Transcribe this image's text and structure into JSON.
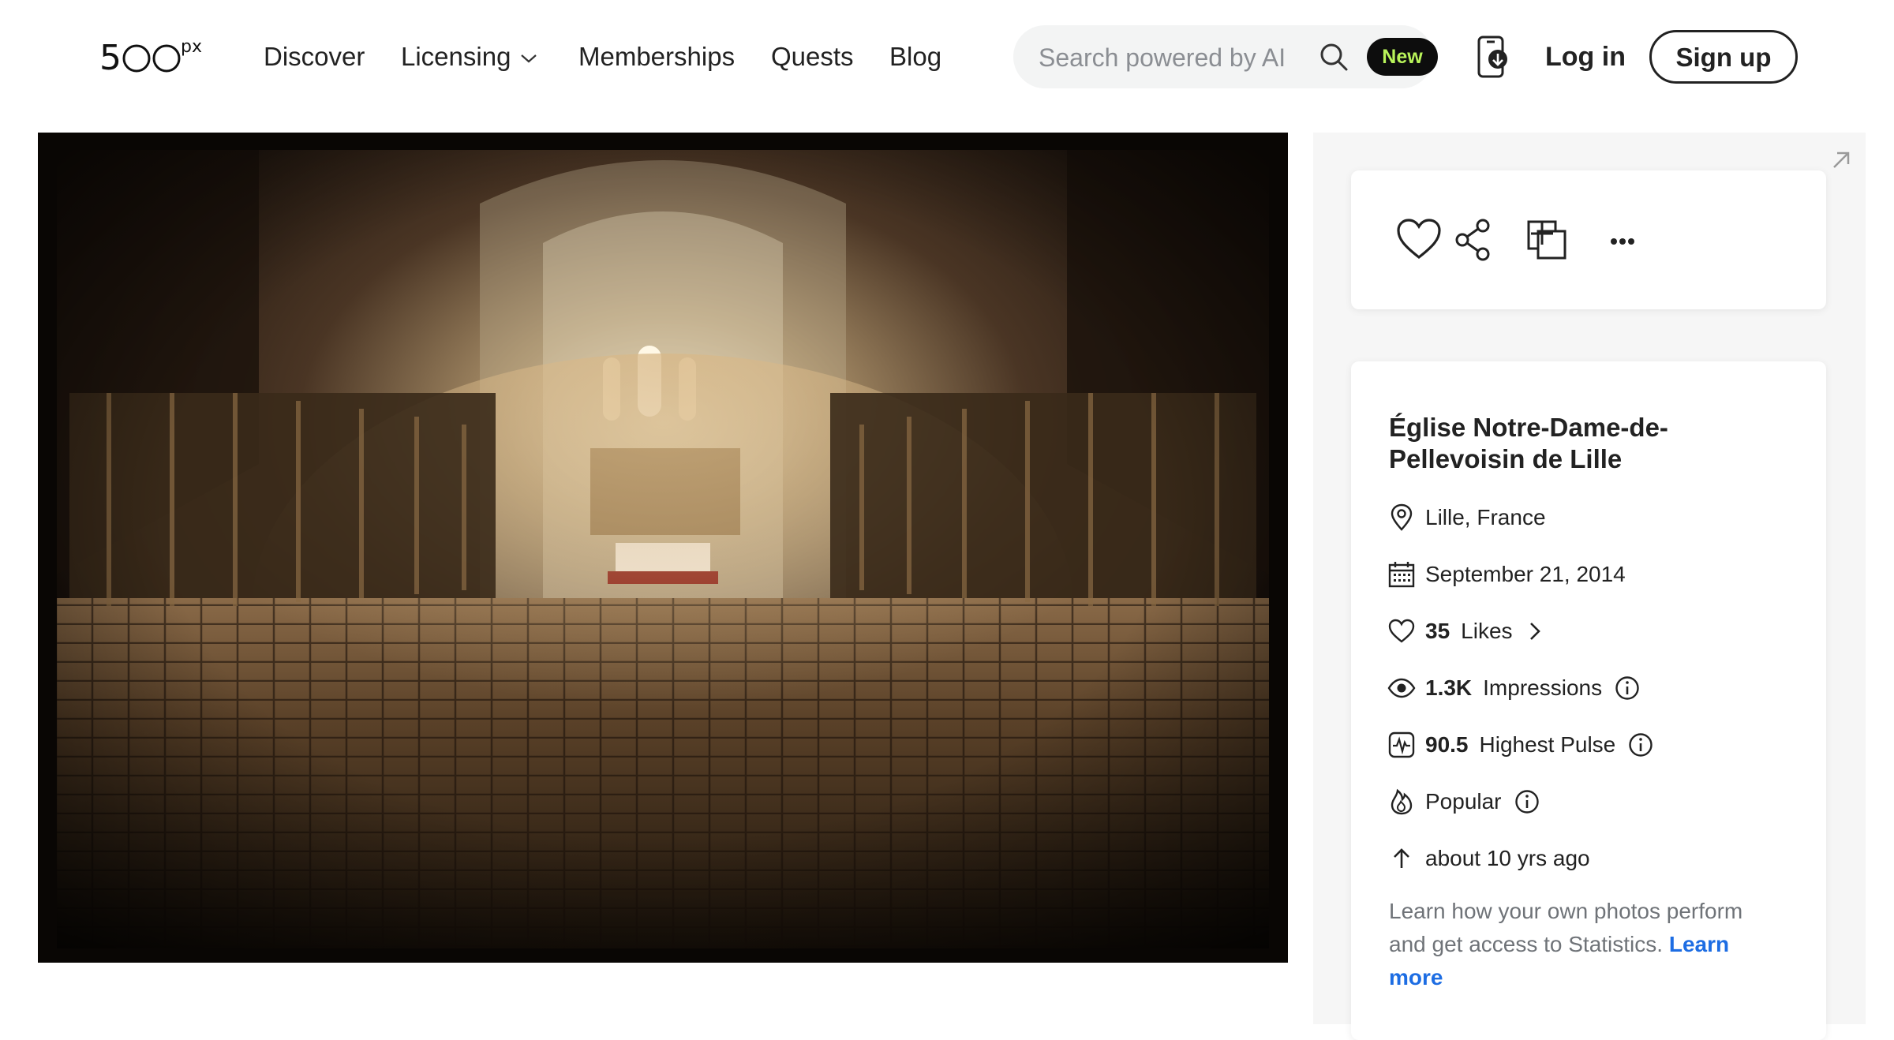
{
  "header": {
    "logo_text": "500px",
    "nav": [
      {
        "label": "Discover"
      },
      {
        "label": "Licensing"
      },
      {
        "label": "Memberships"
      },
      {
        "label": "Quests"
      },
      {
        "label": "Blog"
      }
    ],
    "search": {
      "placeholder": "Search powered by AI",
      "badge": "New"
    },
    "login_label": "Log in",
    "signup_label": "Sign up"
  },
  "photo": {
    "title": "Église Notre-Dame-de-Pellevoisin de Lille",
    "location": "Lille, France",
    "date": "September 21, 2014",
    "likes": {
      "count": "35",
      "label": "Likes"
    },
    "impressions": {
      "count": "1.3K",
      "label": "Impressions"
    },
    "pulse": {
      "value": "90.5",
      "label": "Highest Pulse"
    },
    "popular_label": "Popular",
    "uploaded": "about 10 yrs ago"
  },
  "actions": [
    "heart-icon",
    "share-icon",
    "add-to-gallery-icon",
    "more-icon"
  ],
  "promo": {
    "text": "Learn how your own photos perform and get access to Statistics.",
    "link_label": "Learn more"
  },
  "colors": {
    "accent_link": "#1d6de3",
    "badge_bg": "#0d0d0d",
    "badge_text": "#b9f45a",
    "panel_bg": "#f6f6f6"
  }
}
